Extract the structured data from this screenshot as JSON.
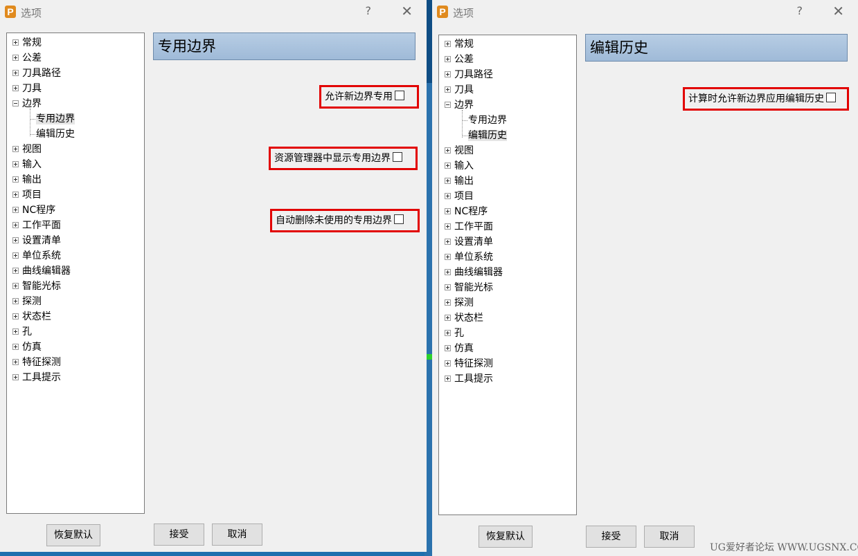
{
  "left": {
    "title": "选项",
    "help": "?",
    "close": "✕",
    "app_icon": "P",
    "tree": [
      {
        "label": "常规",
        "expander": "plus"
      },
      {
        "label": "公差",
        "expander": "plus"
      },
      {
        "label": "刀具路径",
        "expander": "plus"
      },
      {
        "label": "刀具",
        "expander": "plus"
      },
      {
        "label": "边界",
        "expander": "minus"
      },
      {
        "label": "专用边界",
        "expander": "none",
        "child": true,
        "selected": true
      },
      {
        "label": "编辑历史",
        "expander": "none",
        "child": true
      },
      {
        "label": "视图",
        "expander": "plus"
      },
      {
        "label": "输入",
        "expander": "plus"
      },
      {
        "label": "输出",
        "expander": "plus"
      },
      {
        "label": "项目",
        "expander": "plus"
      },
      {
        "label": "NC程序",
        "expander": "plus"
      },
      {
        "label": "工作平面",
        "expander": "plus"
      },
      {
        "label": "设置清单",
        "expander": "plus"
      },
      {
        "label": "单位系统",
        "expander": "plus"
      },
      {
        "label": "曲线编辑器",
        "expander": "plus"
      },
      {
        "label": "智能光标",
        "expander": "plus"
      },
      {
        "label": "探测",
        "expander": "plus"
      },
      {
        "label": "状态栏",
        "expander": "plus"
      },
      {
        "label": "孔",
        "expander": "plus"
      },
      {
        "label": "仿真",
        "expander": "plus"
      },
      {
        "label": "特征探测",
        "expander": "plus"
      },
      {
        "label": "工具提示",
        "expander": "plus"
      }
    ],
    "section_title": "专用边界",
    "options": [
      {
        "label": "允许新边界专用",
        "checked": false
      },
      {
        "label": "资源管理器中显示专用边界",
        "checked": false
      },
      {
        "label": "自动删除未使用的专用边界",
        "checked": false
      }
    ],
    "buttons": {
      "restore": "恢复默认",
      "accept": "接受",
      "cancel": "取消"
    }
  },
  "right": {
    "title": "选项",
    "help": "?",
    "close": "✕",
    "app_icon": "P",
    "tree": [
      {
        "label": "常规",
        "expander": "plus"
      },
      {
        "label": "公差",
        "expander": "plus"
      },
      {
        "label": "刀具路径",
        "expander": "plus"
      },
      {
        "label": "刀具",
        "expander": "plus"
      },
      {
        "label": "边界",
        "expander": "minus"
      },
      {
        "label": "专用边界",
        "expander": "none",
        "child": true
      },
      {
        "label": "编辑历史",
        "expander": "none",
        "child": true,
        "selected": true
      },
      {
        "label": "视图",
        "expander": "plus"
      },
      {
        "label": "输入",
        "expander": "plus"
      },
      {
        "label": "输出",
        "expander": "plus"
      },
      {
        "label": "项目",
        "expander": "plus"
      },
      {
        "label": "NC程序",
        "expander": "plus"
      },
      {
        "label": "工作平面",
        "expander": "plus"
      },
      {
        "label": "设置清单",
        "expander": "plus"
      },
      {
        "label": "单位系统",
        "expander": "plus"
      },
      {
        "label": "曲线编辑器",
        "expander": "plus"
      },
      {
        "label": "智能光标",
        "expander": "plus"
      },
      {
        "label": "探测",
        "expander": "plus"
      },
      {
        "label": "状态栏",
        "expander": "plus"
      },
      {
        "label": "孔",
        "expander": "plus"
      },
      {
        "label": "仿真",
        "expander": "plus"
      },
      {
        "label": "特征探测",
        "expander": "plus"
      },
      {
        "label": "工具提示",
        "expander": "plus"
      }
    ],
    "section_title": "编辑历史",
    "options": [
      {
        "label": "计算时允许新边界应用编辑历史",
        "checked": false
      }
    ],
    "buttons": {
      "restore": "恢复默认",
      "accept": "接受",
      "cancel": "取消"
    }
  },
  "watermark": "UG爱好者论坛 WWW.UGSNX.COM"
}
